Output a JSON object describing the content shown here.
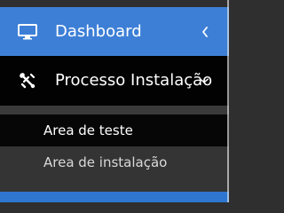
{
  "sidebar": {
    "items": [
      {
        "label": "Dashboard",
        "icon": "monitor-icon",
        "chevron": "chevron-left-icon"
      },
      {
        "label": "Processo Instalação",
        "icon": "tools-icon",
        "chevron": "chevron-down-icon"
      }
    ],
    "submenu": [
      {
        "label": "Area de teste"
      },
      {
        "label": "Area de instalação"
      }
    ]
  },
  "colors": {
    "primary_blue": "#3d7fd6",
    "active_black": "#020202",
    "submenu_gray": "#343434",
    "text_white": "#ffffff",
    "text_gray": "#d9d9d9"
  }
}
